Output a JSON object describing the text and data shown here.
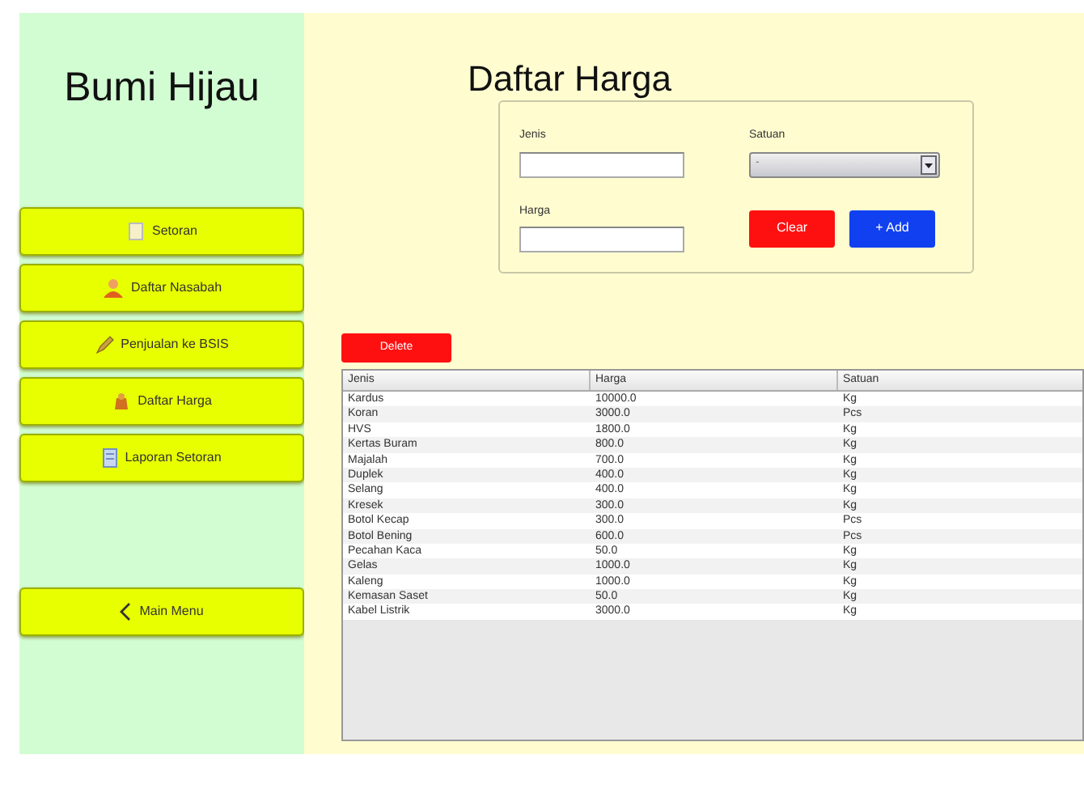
{
  "sidebar": {
    "title": "Bumi Hijau",
    "items": [
      {
        "label": "Setoran"
      },
      {
        "label": "Daftar Nasabah"
      },
      {
        "label": "Penjualan ke BSIS"
      },
      {
        "label": "Daftar Harga"
      },
      {
        "label": "Laporan Setoran"
      }
    ],
    "main_menu": "Main Menu"
  },
  "page_title": "Daftar Harga",
  "form": {
    "jenis_label": "Jenis",
    "harga_label": "Harga",
    "satuan_label": "Satuan",
    "satuan_value": "-",
    "clear": "Clear",
    "add": "+ Add"
  },
  "delete": "Delete",
  "table": {
    "columns": [
      "Jenis",
      "Harga",
      "Satuan"
    ],
    "rows": [
      [
        "Kardus",
        "10000.0",
        "Kg"
      ],
      [
        "Koran",
        "3000.0",
        "Pcs"
      ],
      [
        "HVS",
        "1800.0",
        "Kg"
      ],
      [
        "Kertas Buram",
        "800.0",
        "Kg"
      ],
      [
        "Majalah",
        "700.0",
        "Kg"
      ],
      [
        "Duplek",
        "400.0",
        "Kg"
      ],
      [
        "Selang",
        "400.0",
        "Kg"
      ],
      [
        "Kresek",
        "300.0",
        "Kg"
      ],
      [
        "Botol Kecap",
        "300.0",
        "Pcs"
      ],
      [
        "Botol Bening",
        "600.0",
        "Pcs"
      ],
      [
        "Pecahan Kaca",
        "50.0",
        "Kg"
      ],
      [
        "Gelas",
        "1000.0",
        "Kg"
      ],
      [
        "Kaleng",
        "1000.0",
        "Kg"
      ],
      [
        "Kemasan Saset",
        "50.0",
        "Kg"
      ],
      [
        "Kabel Listrik",
        "3000.0",
        "Kg"
      ]
    ]
  }
}
